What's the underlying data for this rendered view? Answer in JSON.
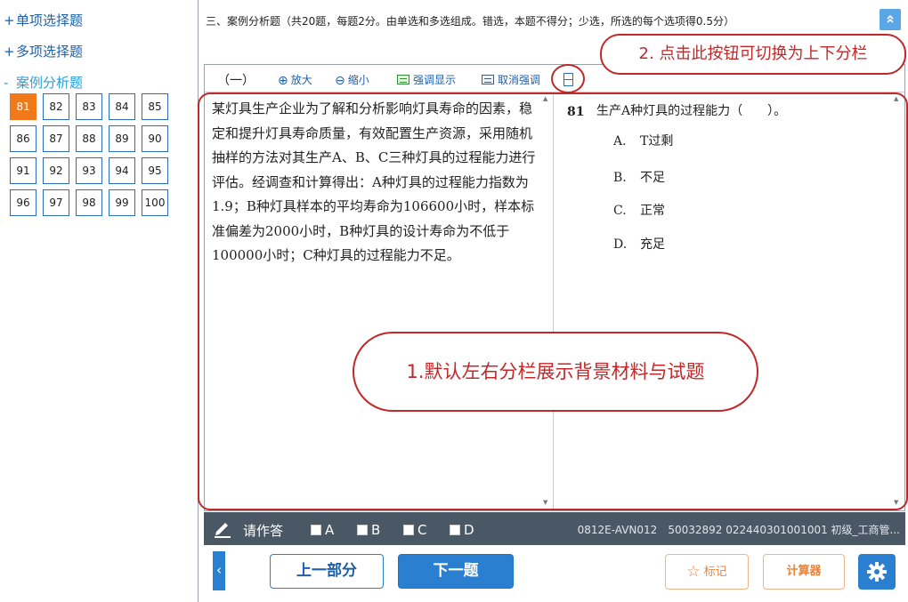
{
  "sidebar": {
    "sections": [
      {
        "sign": "+",
        "label": "单项选择题"
      },
      {
        "sign": "+",
        "label": "多项选择题"
      },
      {
        "sign": "-",
        "label": "案例分析题"
      }
    ],
    "question_numbers": [
      "81",
      "82",
      "83",
      "84",
      "85",
      "86",
      "87",
      "88",
      "89",
      "90",
      "91",
      "92",
      "93",
      "94",
      "95",
      "96",
      "97",
      "98",
      "99",
      "100"
    ],
    "current_question": "81"
  },
  "header": {
    "title": "三、案例分析题（共20题，每题2分。由单选和多选组成。错选，本题不得分；少选，所选的每个选项得0.5分）",
    "collapse_icon": "double-chevron-up-icon"
  },
  "toolbar": {
    "group_label": "（一）",
    "zoom_in": "放大",
    "zoom_out": "缩小",
    "highlight": "强调显示",
    "unhighlight": "取消强调"
  },
  "material": {
    "text": "某灯具生产企业为了解和分析影响灯具寿命的因素，稳定和提升灯具寿命质量，有效配置生产资源，采用随机抽样的方法对其生产A、B、C三种灯具的过程能力进行评估。经调查和计算得出：A种灯具的过程能力指数为1.9；B种灯具样本的平均寿命为106600小时，样本标准偏差为2000小时，B种灯具的设计寿命为不低于100000小时；C种灯具的过程能力不足。"
  },
  "question": {
    "number": "81",
    "text": "生产A种灯具的过程能力（　　）。",
    "options": [
      {
        "letter": "A.",
        "text": "T过剩"
      },
      {
        "letter": "B.",
        "text": "不足"
      },
      {
        "letter": "C.",
        "text": "正常"
      },
      {
        "letter": "D.",
        "text": "充足"
      }
    ]
  },
  "answer_bar": {
    "label": "请作答",
    "choices": [
      "A",
      "B",
      "C",
      "D"
    ],
    "exam_info": "0812E-AVN012　50032892 022440301001001 初级_工商管..."
  },
  "nav": {
    "left_arrow": "‹",
    "prev": "上一部分",
    "next": "下一题",
    "mark": "标记",
    "calculator": "计算器"
  },
  "annotations": {
    "switch_hint": "2. 点击此按钮可切换为上下分栏",
    "default_hint": "1.默认左右分栏展示背景材料与试题"
  },
  "colors": {
    "accent": "#2a7fd0",
    "current_question": "#f07a1a",
    "annotation": "#c0282a",
    "answer_bar": "#4a5866"
  }
}
